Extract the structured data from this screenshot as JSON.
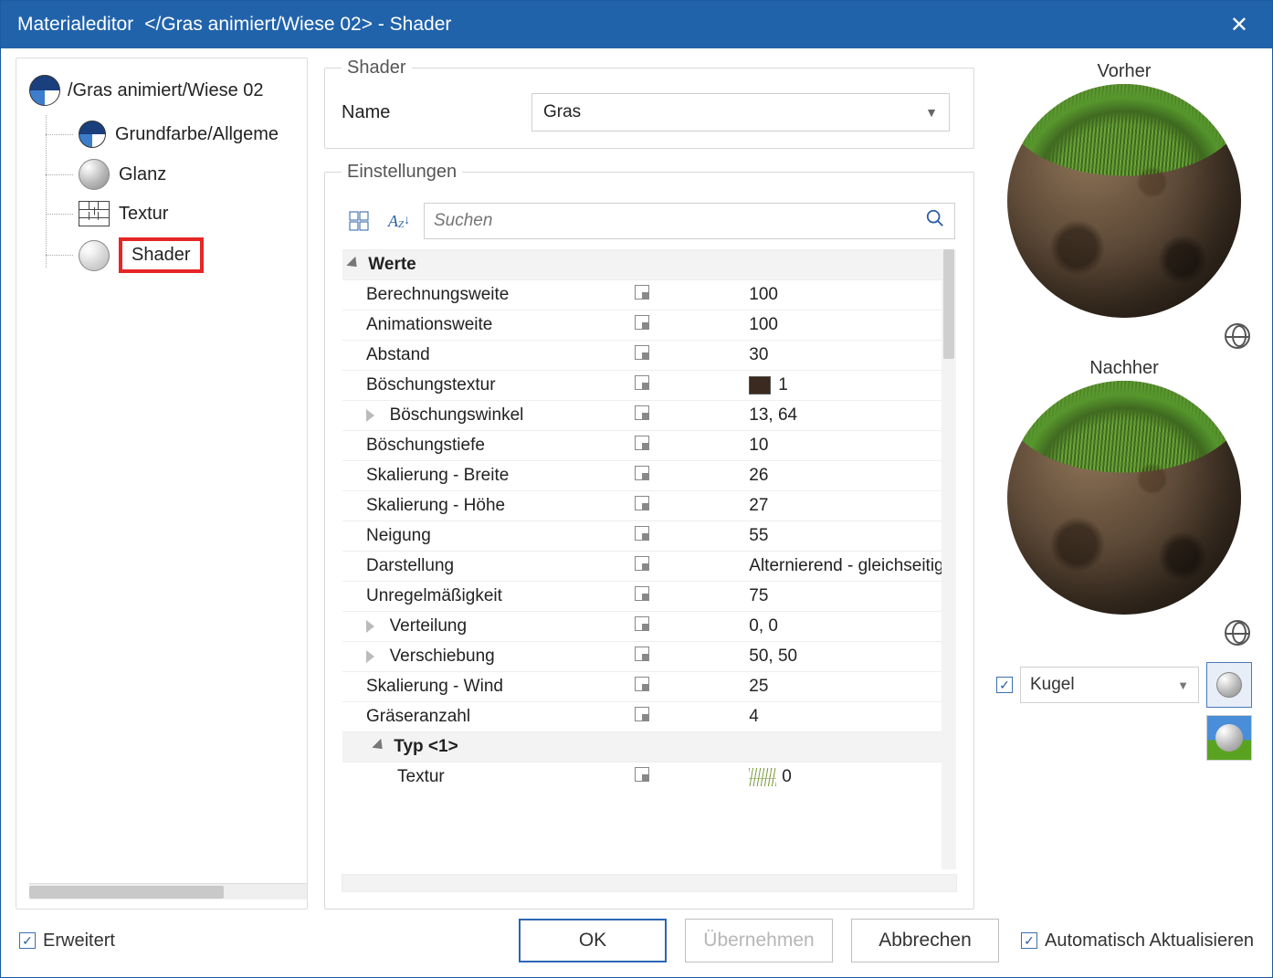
{
  "titlebar": {
    "app": "Materialeditor",
    "breadcrumb": "</Gras animiert/Wiese 02>  - Shader"
  },
  "tree": {
    "root": "/Gras animiert/Wiese 02",
    "items": [
      {
        "label": "Grundfarbe/Allgeme"
      },
      {
        "label": "Glanz"
      },
      {
        "label": "Textur"
      },
      {
        "label": "Shader"
      }
    ]
  },
  "shader": {
    "legend": "Shader",
    "name_label": "Name",
    "name_value": "Gras"
  },
  "settings": {
    "legend": "Einstellungen",
    "search_placeholder": "Suchen",
    "group_header": "Werte",
    "rows": [
      {
        "k": "Berechnungsweite",
        "v": "100"
      },
      {
        "k": "Animationsweite",
        "v": "100"
      },
      {
        "k": "Abstand",
        "v": "30"
      },
      {
        "k": "Böschungstextur",
        "v": "1",
        "swatch": true
      },
      {
        "k": "Böschungswinkel",
        "v": "13, 64",
        "expand": true
      },
      {
        "k": "Böschungstiefe",
        "v": "10"
      },
      {
        "k": "Skalierung - Breite",
        "v": "26"
      },
      {
        "k": "Skalierung - Höhe",
        "v": "27"
      },
      {
        "k": "Neigung",
        "v": "55"
      },
      {
        "k": "Darstellung",
        "v": "Alternierend - gleichseitig"
      },
      {
        "k": "Unregelmäßigkeit",
        "v": "75"
      },
      {
        "k": "Verteilung",
        "v": "0, 0",
        "expand": true
      },
      {
        "k": "Verschiebung",
        "v": "50, 50",
        "expand": true
      },
      {
        "k": "Skalierung - Wind",
        "v": "25"
      },
      {
        "k": "Gräseranzahl",
        "v": "4"
      }
    ],
    "sub_header": "Typ <1>",
    "sub_row": {
      "k": "Textur",
      "v": "0",
      "grass": true
    }
  },
  "preview": {
    "before": "Vorher",
    "after": "Nachher",
    "shape": "Kugel"
  },
  "footer": {
    "advanced": "Erweitert",
    "ok": "OK",
    "apply": "Übernehmen",
    "cancel": "Abbrechen",
    "auto": "Automatisch Aktualisieren"
  }
}
